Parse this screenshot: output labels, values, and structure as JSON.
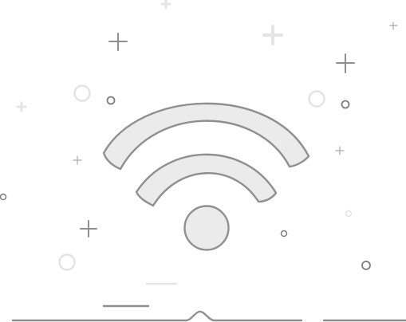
{
  "illustration": {
    "subject": "wifi-icon",
    "colors": {
      "stroke": "#8f8f8f",
      "fill": "#ebebeb",
      "faint": "#e4e4e4",
      "mid": "#a9a9a9",
      "dark": "#7d7d7d"
    }
  }
}
